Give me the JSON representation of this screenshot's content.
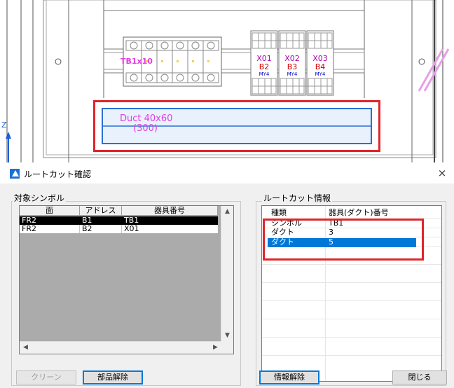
{
  "cad": {
    "tb_label": "TB1x10",
    "relays": [
      {
        "x": "X01",
        "b": "B2",
        "m": "MY4"
      },
      {
        "x": "X02",
        "b": "B3",
        "m": "MY4"
      },
      {
        "x": "X03",
        "b": "B4",
        "m": "MY4"
      }
    ],
    "duct_label": "Duct 40x60",
    "duct_sub": "(300)",
    "axis_label": "Z"
  },
  "dialog": {
    "title": "ルートカット確認",
    "close_glyph": "×",
    "left_group": "対象シンボル",
    "right_group": "ルートカット情報",
    "symbols_table": {
      "headers": [
        "面",
        "アドレス",
        "器具番号"
      ],
      "rows": [
        {
          "face": "FR2",
          "address": "B1",
          "device": "TB1",
          "selected": true
        },
        {
          "face": "FR2",
          "address": "B2",
          "device": "X01",
          "selected": false
        }
      ]
    },
    "info_table": {
      "headers": [
        "種類",
        "器具(ダクト)番号"
      ],
      "rows": [
        {
          "kind": "シンボル",
          "number": "TB1",
          "selected": false
        },
        {
          "kind": "ダクト",
          "number": "3",
          "selected": false
        },
        {
          "kind": "ダクト",
          "number": "5",
          "selected": true
        }
      ]
    },
    "buttons": {
      "clear": "クリーン",
      "release_part": "部品解除",
      "release_info": "情報解除",
      "close": "閉じる"
    },
    "colors": {
      "accent": "#0078d7",
      "highlight_red": "#e0242b",
      "selected_black": "#000000"
    }
  }
}
